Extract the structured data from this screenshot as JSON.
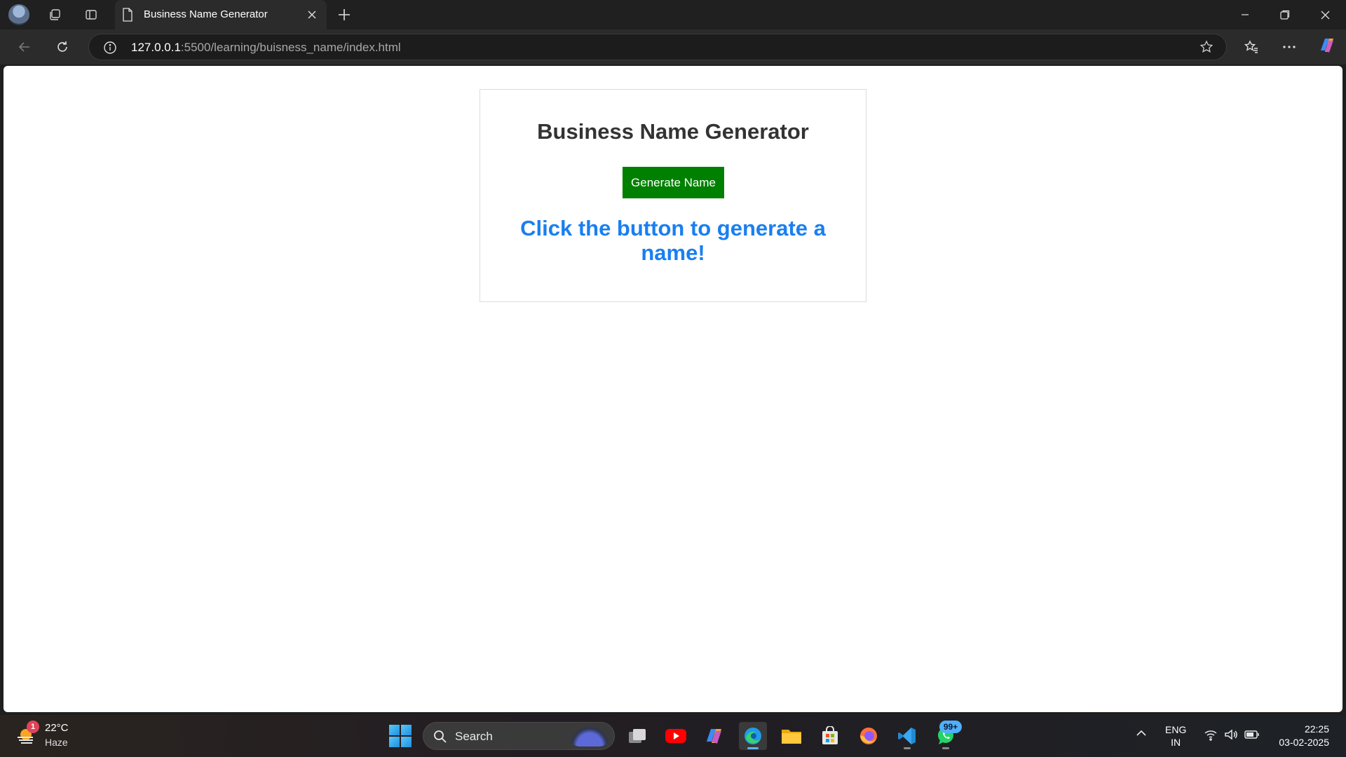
{
  "browser": {
    "tab_title": "Business Name Generator",
    "url_host": "127.0.0.1",
    "url_rest": ":5500/learning/buisness_name/index.html"
  },
  "page": {
    "heading": "Business Name Generator",
    "button_label": "Generate Name",
    "result_text": "Click the button to generate a name!",
    "colors": {
      "button": "#008000",
      "result": "#1a7ff0",
      "heading": "#333333"
    }
  },
  "taskbar": {
    "weather_temp": "22°C",
    "weather_condition": "Haze",
    "weather_badge": "1",
    "search_label": "Search",
    "apps": [
      "task-view",
      "youtube",
      "copilot",
      "edge",
      "file-explorer",
      "microsoft-store",
      "firefox",
      "vscode",
      "whatsapp"
    ],
    "whatsapp_badge": "99+",
    "lang_line1": "ENG",
    "lang_line2": "IN",
    "time": "22:25",
    "date": "03-02-2025"
  }
}
